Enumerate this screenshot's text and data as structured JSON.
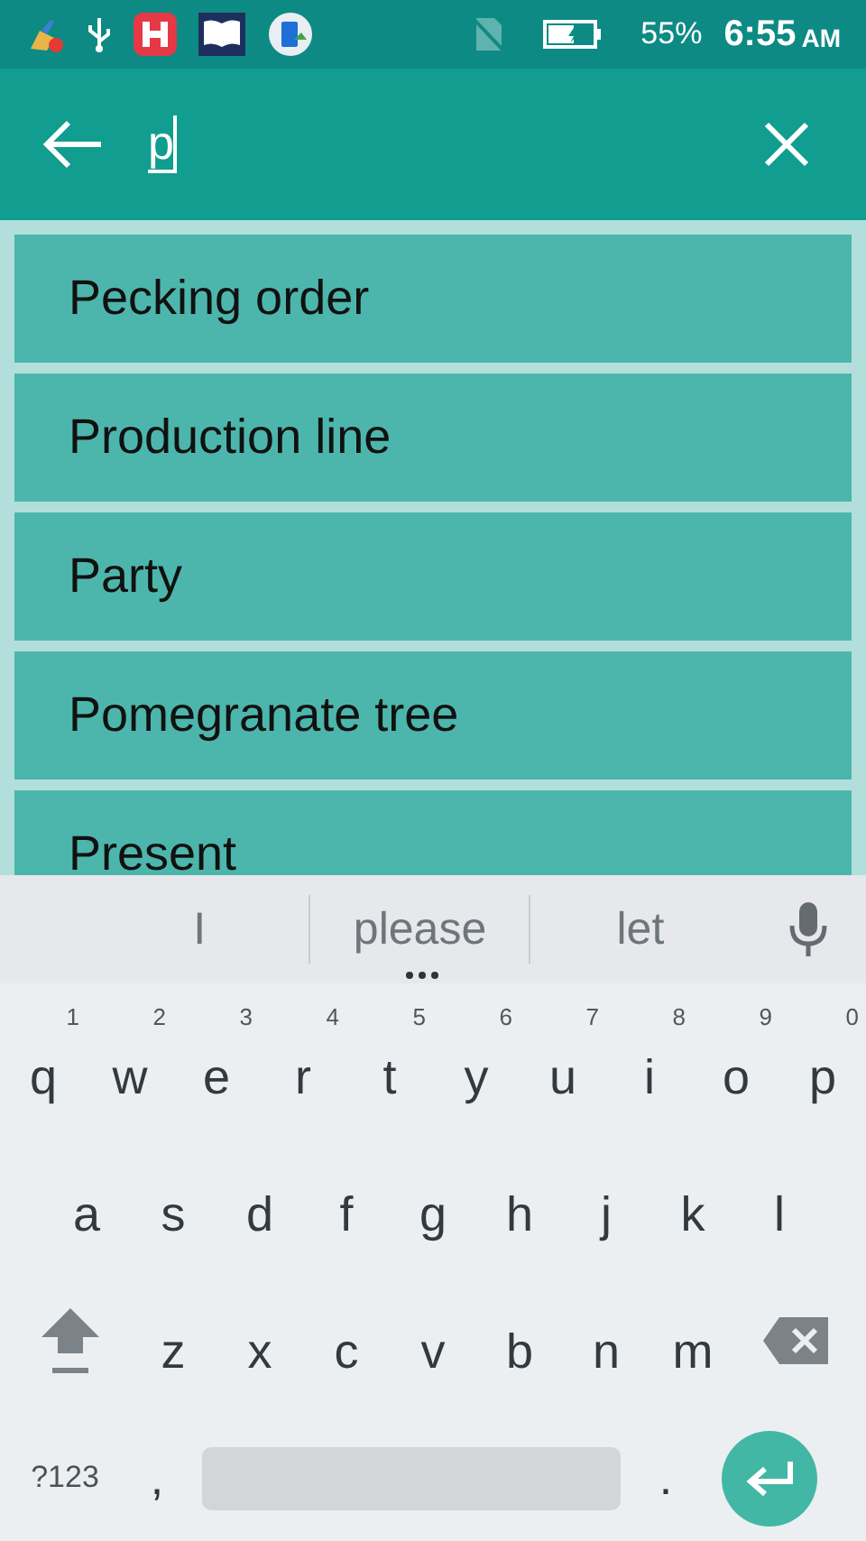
{
  "status_bar": {
    "battery_text": "55%",
    "time": "6:55",
    "time_suffix": "AM"
  },
  "search": {
    "value": "p"
  },
  "results": [
    {
      "label": "Pecking order"
    },
    {
      "label": "Production line"
    },
    {
      "label": "Party"
    },
    {
      "label": "Pomegranate tree"
    },
    {
      "label": "Present"
    }
  ],
  "keyboard": {
    "suggestions": [
      {
        "label": "I",
        "selected": false
      },
      {
        "label": "please",
        "selected": true
      },
      {
        "label": "let",
        "selected": false
      }
    ],
    "rows": [
      [
        {
          "label": "q",
          "hint": "1"
        },
        {
          "label": "w",
          "hint": "2"
        },
        {
          "label": "e",
          "hint": "3"
        },
        {
          "label": "r",
          "hint": "4"
        },
        {
          "label": "t",
          "hint": "5"
        },
        {
          "label": "y",
          "hint": "6"
        },
        {
          "label": "u",
          "hint": "7"
        },
        {
          "label": "i",
          "hint": "8"
        },
        {
          "label": "o",
          "hint": "9"
        },
        {
          "label": "p",
          "hint": "0"
        }
      ],
      [
        {
          "label": "a"
        },
        {
          "label": "s"
        },
        {
          "label": "d"
        },
        {
          "label": "f"
        },
        {
          "label": "g"
        },
        {
          "label": "h"
        },
        {
          "label": "j"
        },
        {
          "label": "k"
        },
        {
          "label": "l"
        }
      ],
      [
        {
          "label": "z"
        },
        {
          "label": "x"
        },
        {
          "label": "c"
        },
        {
          "label": "v"
        },
        {
          "label": "b"
        },
        {
          "label": "n"
        },
        {
          "label": "m"
        }
      ]
    ],
    "symbols_key": "?123",
    "comma_key": ",",
    "period_key": "."
  }
}
